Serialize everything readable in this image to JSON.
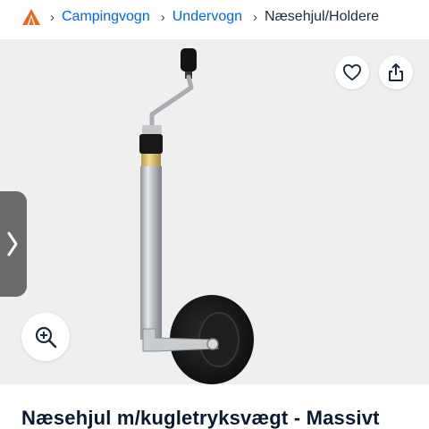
{
  "breadcrumb": {
    "logo_icon": "tent-logo-icon",
    "items": [
      {
        "label": "Campingvogn",
        "link": true
      },
      {
        "label": "Undervogn",
        "link": true
      },
      {
        "label": "Næsehjul/Holdere",
        "link": false
      }
    ]
  },
  "gallery": {
    "favorite_icon": "heart-icon",
    "share_icon": "share-icon",
    "prev_icon": "chevron-right-icon",
    "zoom_icon": "zoom-in-icon"
  },
  "listing": {
    "title": "Næsehjul m/kugletryksvægt - Massivt"
  },
  "colors": {
    "link": "#0063fb",
    "gallery_bg": "#efefef",
    "logo_orange": "#f0641e"
  }
}
